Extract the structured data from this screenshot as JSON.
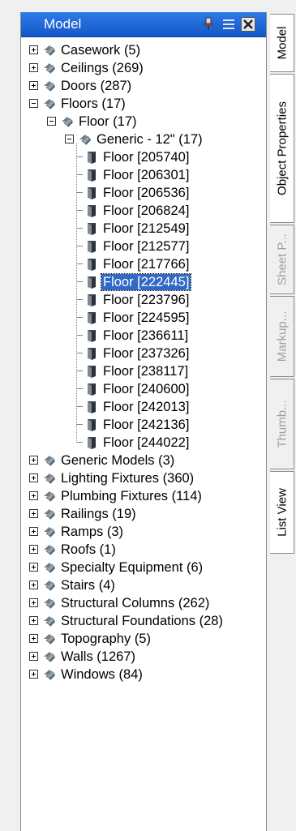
{
  "panel": {
    "title": "Model"
  },
  "tree": [
    {
      "level": 0,
      "state": "collapsed",
      "icon": "category-icon",
      "label": "Casework (5)"
    },
    {
      "level": 0,
      "state": "collapsed",
      "icon": "category-icon",
      "label": "Ceilings (269)"
    },
    {
      "level": 0,
      "state": "collapsed",
      "icon": "category-icon",
      "label": "Doors (287)"
    },
    {
      "level": 0,
      "state": "expanded",
      "icon": "category-icon",
      "label": "Floors (17)"
    },
    {
      "level": 1,
      "state": "expanded",
      "icon": "category-icon",
      "label": "Floor (17)"
    },
    {
      "level": 2,
      "state": "expanded",
      "icon": "category-icon",
      "label": "Generic - 12\" (17)"
    },
    {
      "level": 3,
      "state": "leaf",
      "icon": "element-icon",
      "label": "Floor [205740]"
    },
    {
      "level": 3,
      "state": "leaf",
      "icon": "element-icon",
      "label": "Floor [206301]"
    },
    {
      "level": 3,
      "state": "leaf",
      "icon": "element-icon",
      "label": "Floor [206536]"
    },
    {
      "level": 3,
      "state": "leaf",
      "icon": "element-icon",
      "label": "Floor [206824]"
    },
    {
      "level": 3,
      "state": "leaf",
      "icon": "element-icon",
      "label": "Floor [212549]"
    },
    {
      "level": 3,
      "state": "leaf",
      "icon": "element-icon",
      "label": "Floor [212577]"
    },
    {
      "level": 3,
      "state": "leaf",
      "icon": "element-icon",
      "label": "Floor [217766]"
    },
    {
      "level": 3,
      "state": "leaf",
      "icon": "element-icon",
      "label": "Floor [222445]",
      "selected": true
    },
    {
      "level": 3,
      "state": "leaf",
      "icon": "element-icon",
      "label": "Floor [223796]"
    },
    {
      "level": 3,
      "state": "leaf",
      "icon": "element-icon",
      "label": "Floor [224595]"
    },
    {
      "level": 3,
      "state": "leaf",
      "icon": "element-icon",
      "label": "Floor [236611]"
    },
    {
      "level": 3,
      "state": "leaf",
      "icon": "element-icon",
      "label": "Floor [237326]"
    },
    {
      "level": 3,
      "state": "leaf",
      "icon": "element-icon",
      "label": "Floor [238117]"
    },
    {
      "level": 3,
      "state": "leaf",
      "icon": "element-icon",
      "label": "Floor [240600]"
    },
    {
      "level": 3,
      "state": "leaf",
      "icon": "element-icon",
      "label": "Floor [242013]"
    },
    {
      "level": 3,
      "state": "leaf",
      "icon": "element-icon",
      "label": "Floor [242136]"
    },
    {
      "level": 3,
      "state": "leaf",
      "icon": "element-icon",
      "label": "Floor [244022]"
    },
    {
      "level": 0,
      "state": "collapsed",
      "icon": "category-icon",
      "label": "Generic Models (3)"
    },
    {
      "level": 0,
      "state": "collapsed",
      "icon": "category-icon",
      "label": "Lighting Fixtures (360)"
    },
    {
      "level": 0,
      "state": "collapsed",
      "icon": "category-icon",
      "label": "Plumbing Fixtures (114)"
    },
    {
      "level": 0,
      "state": "collapsed",
      "icon": "category-icon",
      "label": "Railings (19)"
    },
    {
      "level": 0,
      "state": "collapsed",
      "icon": "category-icon",
      "label": "Ramps (3)"
    },
    {
      "level": 0,
      "state": "collapsed",
      "icon": "category-icon",
      "label": "Roofs (1)"
    },
    {
      "level": 0,
      "state": "collapsed",
      "icon": "category-icon",
      "label": "Specialty Equipment (6)"
    },
    {
      "level": 0,
      "state": "collapsed",
      "icon": "category-icon",
      "label": "Stairs (4)"
    },
    {
      "level": 0,
      "state": "collapsed",
      "icon": "category-icon",
      "label": "Structural Columns (262)"
    },
    {
      "level": 0,
      "state": "collapsed",
      "icon": "category-icon",
      "label": "Structural Foundations (28)"
    },
    {
      "level": 0,
      "state": "collapsed",
      "icon": "category-icon",
      "label": "Topography (5)"
    },
    {
      "level": 0,
      "state": "collapsed",
      "icon": "category-icon",
      "label": "Walls (1267)"
    },
    {
      "level": 0,
      "state": "collapsed",
      "icon": "category-icon",
      "label": "Windows (84)"
    }
  ],
  "tabs": [
    {
      "id": "model",
      "label": "Model",
      "active": true
    },
    {
      "id": "object-properties",
      "label": "Object Properties",
      "active": true
    },
    {
      "id": "sheet-properties",
      "label": "Sheet P...",
      "active": false
    },
    {
      "id": "markup",
      "label": "Markup...",
      "active": false
    },
    {
      "id": "thumbnails",
      "label": "Thumb...",
      "active": false
    },
    {
      "id": "list-view",
      "label": "List View",
      "active": true
    }
  ],
  "colors": {
    "title_bar": "#1f66d6",
    "selection": "#316ac5"
  }
}
